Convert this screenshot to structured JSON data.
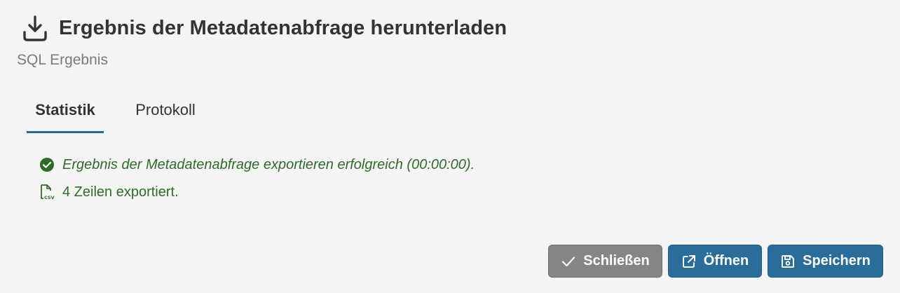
{
  "dialog": {
    "title": "Ergebnis der Metadatenabfrage herunterladen",
    "subtitle": "SQL Ergebnis"
  },
  "tabs": [
    {
      "label": "Statistik",
      "active": true
    },
    {
      "label": "Protokoll",
      "active": false
    }
  ],
  "status": {
    "success_message": "Ergebnis der Metadatenabfrage exportieren erfolgreich (00:00:00).",
    "rows_message": "4 Zeilen exportiert.",
    "file_icon_label": "CSV"
  },
  "buttons": {
    "close_label": "Schließen",
    "open_label": "Öffnen",
    "save_label": "Speichern"
  },
  "colors": {
    "accent": "#2a6d9b",
    "success": "#2f6b28",
    "neutral_button": "#858585",
    "background": "#f5f5f5"
  },
  "icons": {
    "title": "download-icon",
    "success": "check-circle-icon",
    "file": "csv-file-icon",
    "close": "checkmark-icon",
    "open": "external-link-icon",
    "save": "floppy-disk-icon"
  }
}
